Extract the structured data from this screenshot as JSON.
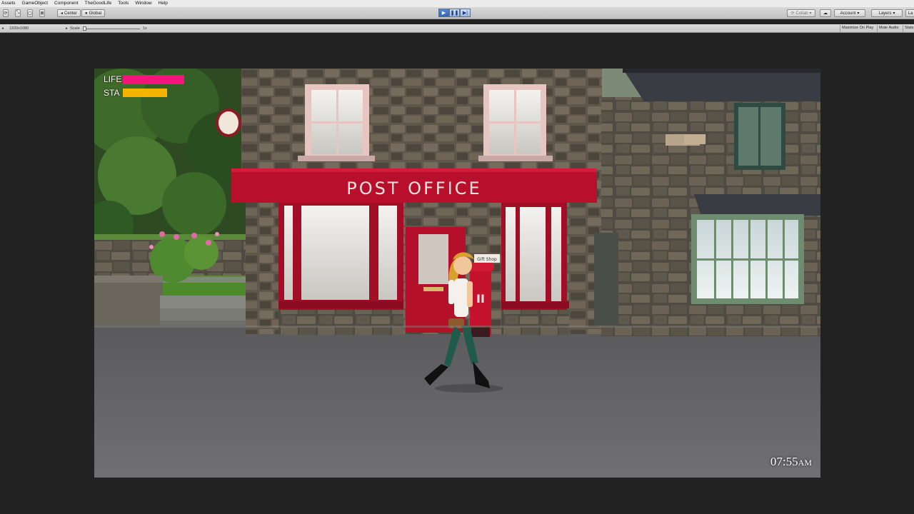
{
  "menubar": {
    "items": [
      "Assets",
      "GameObject",
      "Component",
      "TheGoodLife",
      "Tools",
      "Window",
      "Help"
    ]
  },
  "toolbar": {
    "pivot_label": "Center",
    "space_label": "Global",
    "collab_label": "Collab",
    "account_label": "Account",
    "layers_label": "Layers",
    "layout_label": "La",
    "play_state": "playing"
  },
  "game_view": {
    "resolution": "1920x1080",
    "scale_label": "Scale",
    "scale_value": "1x",
    "maximize_on_play": "Maximize On Play",
    "mute_audio": "Mute Audio",
    "stats": "Stats"
  },
  "hud": {
    "life_label": "LIFE",
    "life_fraction": 0.86,
    "life_color": "#f4157a",
    "sta_label": "STA",
    "sta_fraction": 0.62,
    "sta_color": "#f5b400",
    "time": "07:55",
    "ampm": "AM"
  },
  "scene": {
    "shop_sign": "POST OFFICE",
    "small_sign": "Gift Shop",
    "pause_glyph": "II"
  }
}
